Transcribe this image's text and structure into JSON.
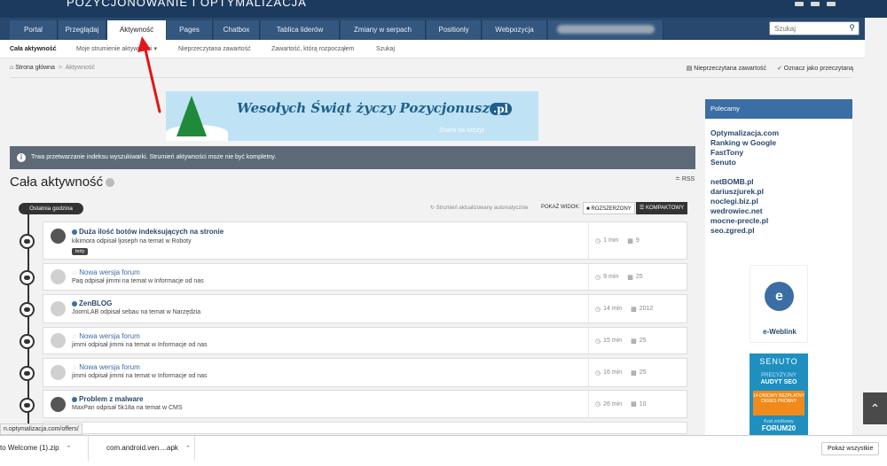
{
  "header": {
    "brand": "POZYCJONOWANIE I OPTYMALIZACJA"
  },
  "nav": {
    "tabs": [
      {
        "label": "Portal"
      },
      {
        "label": "Przeglądaj"
      },
      {
        "label": "Aktywność"
      },
      {
        "label": "Pages"
      },
      {
        "label": "Chatbox"
      },
      {
        "label": "Tablica liderów"
      },
      {
        "label": "Zmiany w serpach"
      },
      {
        "label": "Positionly"
      },
      {
        "label": "Webpozycja"
      }
    ],
    "search_placeholder": "Szukaj"
  },
  "subnav": {
    "items": [
      {
        "label": "Cała aktywność"
      },
      {
        "label": "Moje strumienie aktywności ▾"
      },
      {
        "label": "Nieprzeczytana zawartość"
      },
      {
        "label": "Zawartość, którą rozpocząłem"
      },
      {
        "label": "Szukaj"
      }
    ]
  },
  "breadcrumb": {
    "home": "Strona główna",
    "sep": ">",
    "current": "Aktywność"
  },
  "actions": {
    "unread": "Nieprzeczytana zawartość",
    "mark_read": "Oznacz jako przeczytaną"
  },
  "banner": {
    "text": "Wesołych Świąt życzy Pozycjonusz",
    "domain": ".pl",
    "subtitle": "Znami na szczyt"
  },
  "notice": "Trwa przetwarzanie indeksu wyszukiwarki. Strumień aktywności może nie być kompletny.",
  "page": {
    "title": "Cała aktywność",
    "rss": "RSS"
  },
  "stream": {
    "time_pill": "Ostatnia godzina",
    "auto_update": "Strumień aktualizowany automatycznie",
    "view_label": "POKAŻ WIDOK:",
    "view_expanded": "ROZSZERZONY",
    "view_compact": "KOMPAKTOWY"
  },
  "items": [
    {
      "title": "Duża ilość botów indeksujących na stronie",
      "meta": "kikimora odpisał ljoseph na temat w Roboty",
      "tag": "boty",
      "time": "1 min",
      "replies": "9"
    },
    {
      "title": "Nowa wersja forum",
      "meta": "Paq odpisał jimmi na temat w Informacje od nas",
      "time": "9 min",
      "replies": "25"
    },
    {
      "title": "ZenBLOG",
      "meta": "JoomLAB odpisał sebau na temat w Narzędzia",
      "time": "14 min",
      "replies": "2012"
    },
    {
      "title": "Nowa wersja forum",
      "meta": "jimmi odpisał jimmi na temat w Informacje od nas",
      "time": "15 min",
      "replies": "25"
    },
    {
      "title": "Nowa wersja forum",
      "meta": "jimmi odpisał jimmi na temat w Informacje od nas",
      "time": "16 min",
      "replies": "25"
    },
    {
      "title": "Problem z malware",
      "meta": "MaxPan odpisał 5k18a na temat w CMS",
      "time": "26 min",
      "replies": "10"
    }
  ],
  "sidebar": {
    "heading": "Polecamy",
    "links1": [
      "Optymalizacja.com",
      "Ranking w Google",
      "FastTony",
      "Senuto"
    ],
    "links2": [
      "netBOMB.pl",
      "dariuszjurek.pl",
      "noclegi.biz.pl",
      "wedrowiec.net",
      "mocne-precle.pl",
      "seo.zgred.pl"
    ],
    "ad1_letter": "e",
    "ad1_caption": "e-Weblink",
    "ad2": {
      "brand": "SENUTO",
      "l1": "PRECYZYJNY",
      "l2": "AUDYT SEO",
      "offer": "14-DNIOWY BEZPŁATNY OKRES PRÓBNY",
      "code_label": "Kod zniżkowy",
      "code": "FORUM20"
    }
  },
  "status_url": "n.optymalizacja.com/offers/",
  "downloads": {
    "items": [
      "to Welcome (1).zip",
      "com.android.ven....apk"
    ],
    "show_all": "Pokaż wszystkie"
  }
}
